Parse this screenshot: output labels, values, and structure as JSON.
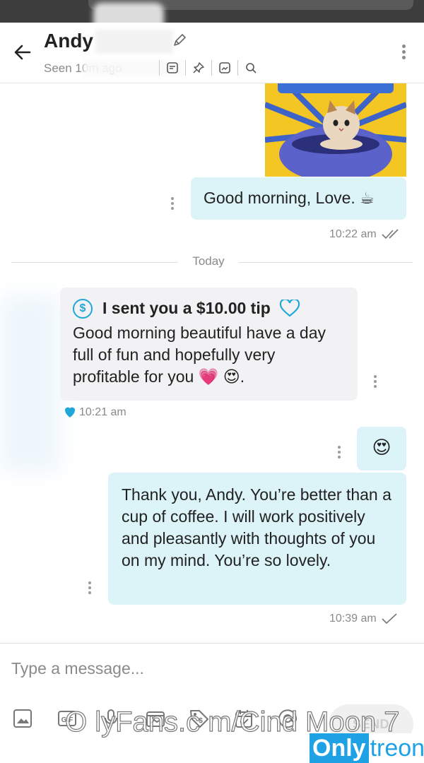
{
  "header": {
    "name": "Andy",
    "seen": "Seen 10m ago",
    "icons": [
      "edit-icon",
      "notes-icon",
      "pin-icon",
      "media-icon",
      "search-icon"
    ]
  },
  "messages": {
    "sent_1": {
      "text": "Good morning, Love. ☕",
      "time": "10:22 am"
    },
    "date_separator": "Today",
    "received_tip": {
      "tip_label": "I sent you a $10.00 tip",
      "text": "Good morning beautiful have a day full of fun and hopefully very profitable for you 💗 😍.",
      "time": "10:21 am"
    },
    "sent_emoji": {
      "text": "😍"
    },
    "sent_2": {
      "text": "Thank you, Andy. You’re better than a cup of coffee. I will work positively and pleasantly with thoughts of you on my mind. You’re so lovely.",
      "time": "10:39 am"
    }
  },
  "composer": {
    "placeholder": "Type a message...",
    "send_label": "SEND",
    "tools": [
      "image-icon",
      "gif-icon",
      "mic-icon",
      "vault-icon",
      "price-tag-icon",
      "schedule-icon",
      "mention-icon"
    ]
  },
  "watermark": {
    "text": "O lyFans.c m/Cind  Moon 7",
    "brand_only": "Only",
    "brand_rest": "treon"
  },
  "colors": {
    "accent": "#1ea7d8",
    "sent_bubble": "#dcf3f8",
    "received_bubble": "#f2f2f4"
  }
}
